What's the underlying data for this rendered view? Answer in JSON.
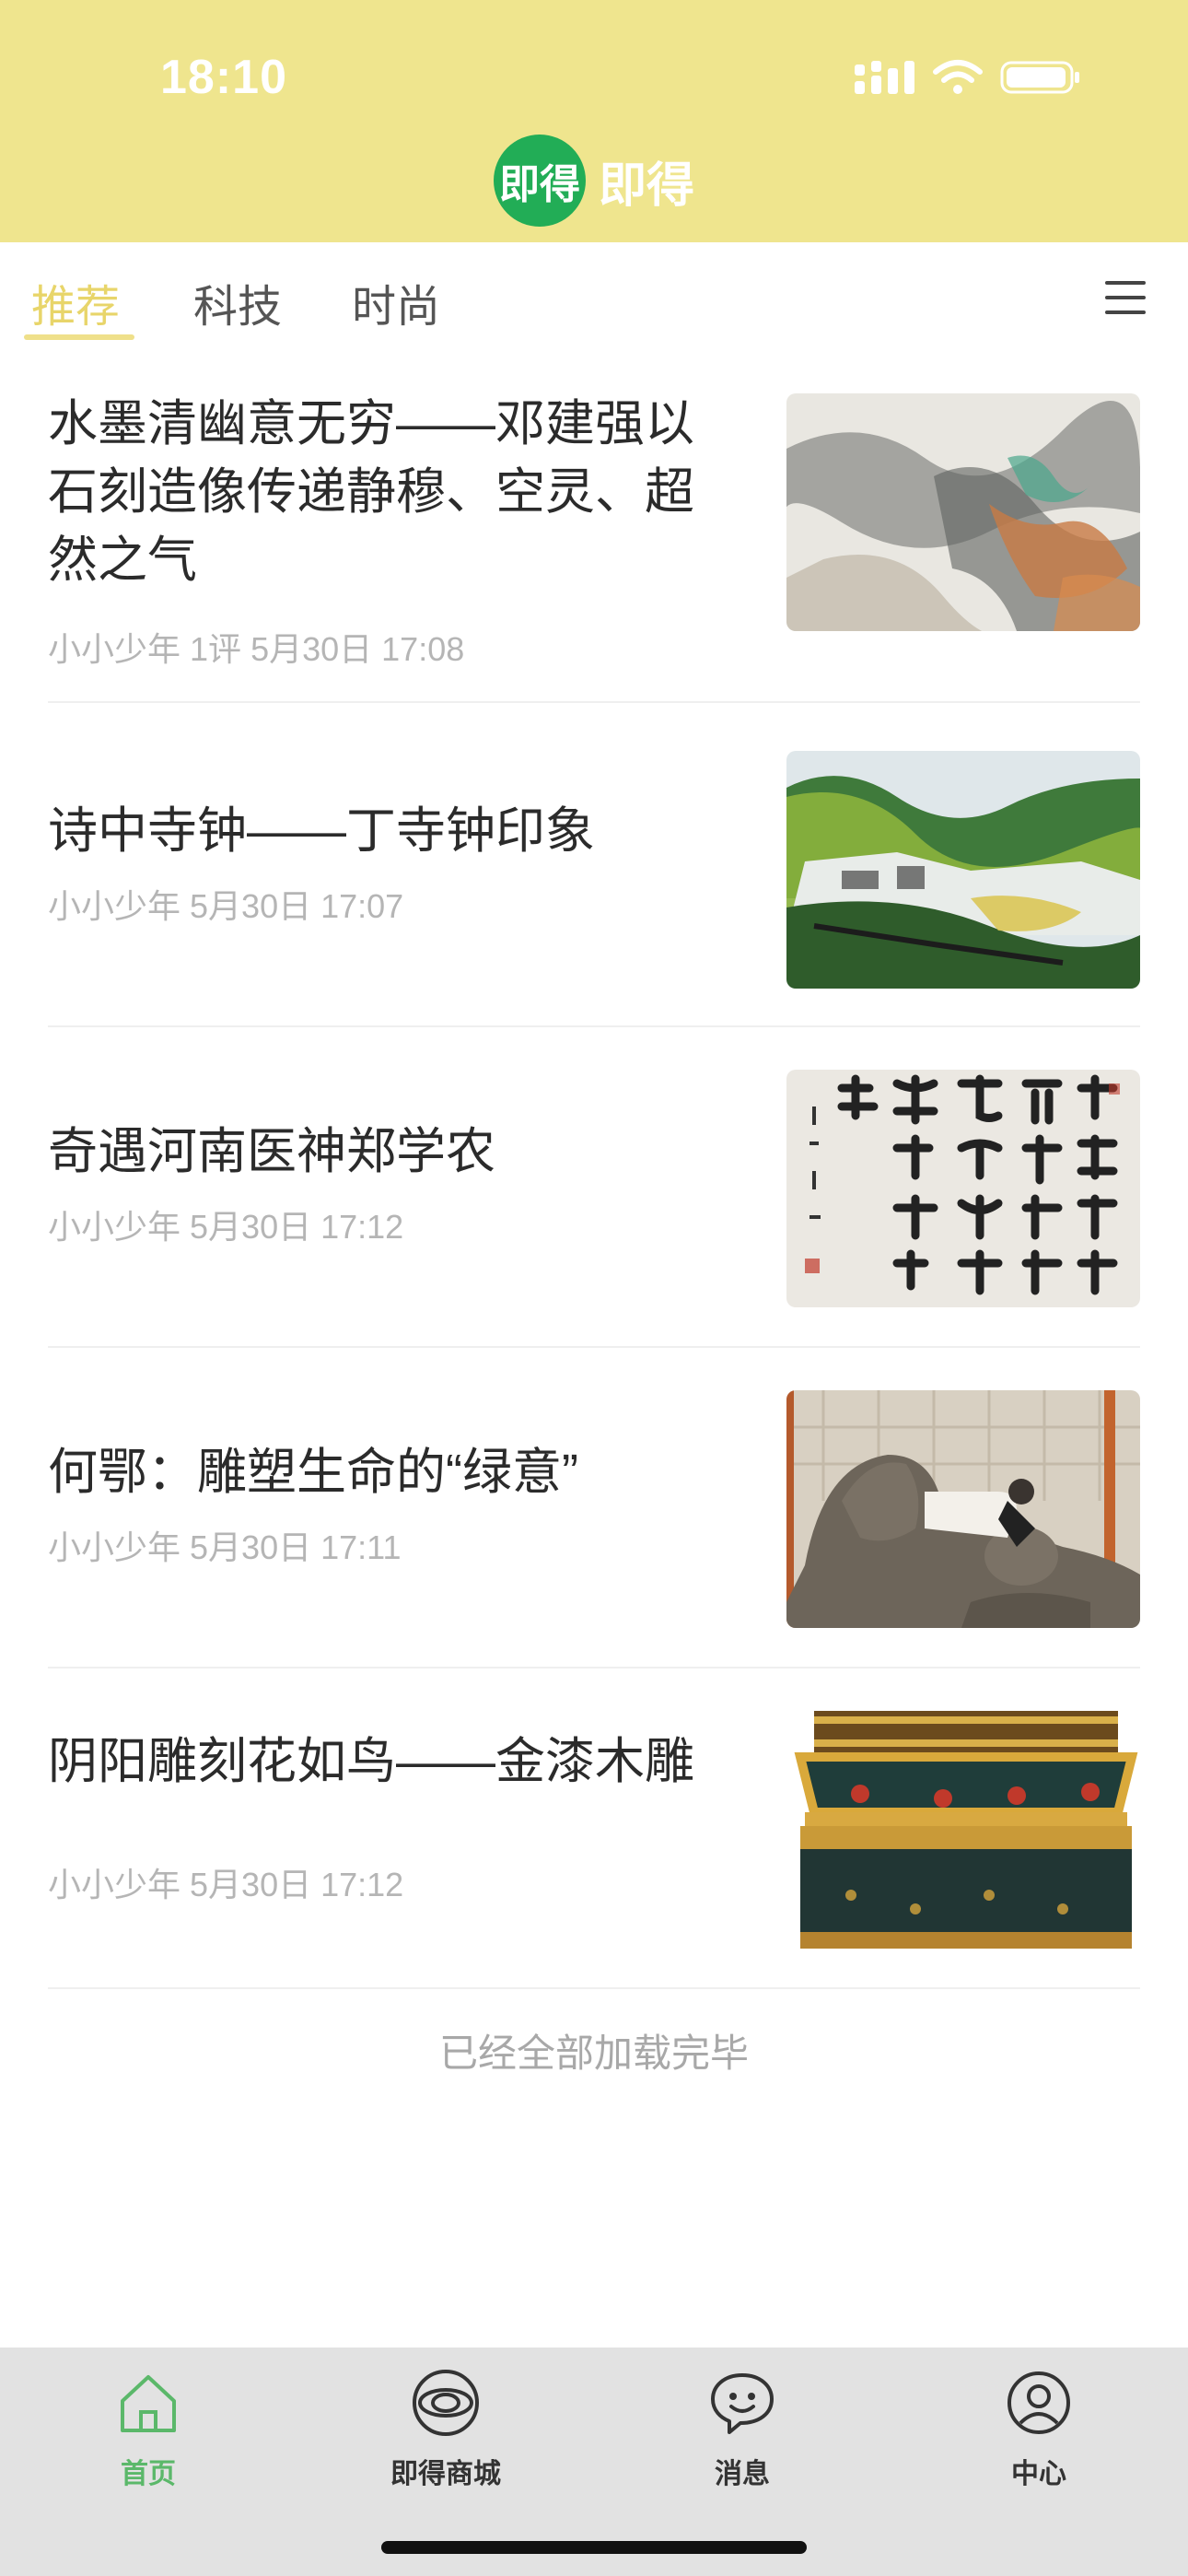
{
  "status_bar": {
    "time": "18:10"
  },
  "brand": {
    "logo_text": "即得",
    "name": "即得"
  },
  "tabs": [
    {
      "label": "推荐",
      "active": true
    },
    {
      "label": "科技",
      "active": false
    },
    {
      "label": "时尚",
      "active": false
    }
  ],
  "articles": [
    {
      "title": "水墨清幽意无穷——邓建强以石刻造像传递静穆、空灵、超然之气",
      "author": "小小少年",
      "comments": "1评",
      "date": "5月30日 17:08",
      "thumb_icon": "ink-landscape-image"
    },
    {
      "title": "诗中寺钟——丁寺钟印象",
      "author": "小小少年",
      "comments": "",
      "date": "5月30日 17:07",
      "thumb_icon": "watercolor-landscape-image"
    },
    {
      "title": "奇遇河南医神郑学农",
      "author": "小小少年",
      "comments": "",
      "date": "5月30日 17:12",
      "thumb_icon": "calligraphy-image"
    },
    {
      "title": "何鄂：雕塑生命的“绿意”",
      "author": "小小少年",
      "comments": "",
      "date": "5月30日 17:11",
      "thumb_icon": "sculpture-image"
    },
    {
      "title": "阴阳雕刻花如鸟——金漆木雕",
      "author": "小小少年",
      "comments": "",
      "date": "5月30日 17:12",
      "thumb_icon": "gold-lacquer-carving-image"
    }
  ],
  "feed_end_text": "已经全部加载完毕",
  "bottom_nav": [
    {
      "label": "首页",
      "icon": "home-icon",
      "active": true
    },
    {
      "label": "即得商城",
      "icon": "store-icon",
      "active": false
    },
    {
      "label": "消息",
      "icon": "message-icon",
      "active": false
    },
    {
      "label": "中心",
      "icon": "profile-icon",
      "active": false
    }
  ],
  "colors": {
    "header_bg": "#efe58e",
    "tab_active": "#e8d56a",
    "brand_green": "#22ad56",
    "nav_active": "#5bb86a"
  }
}
